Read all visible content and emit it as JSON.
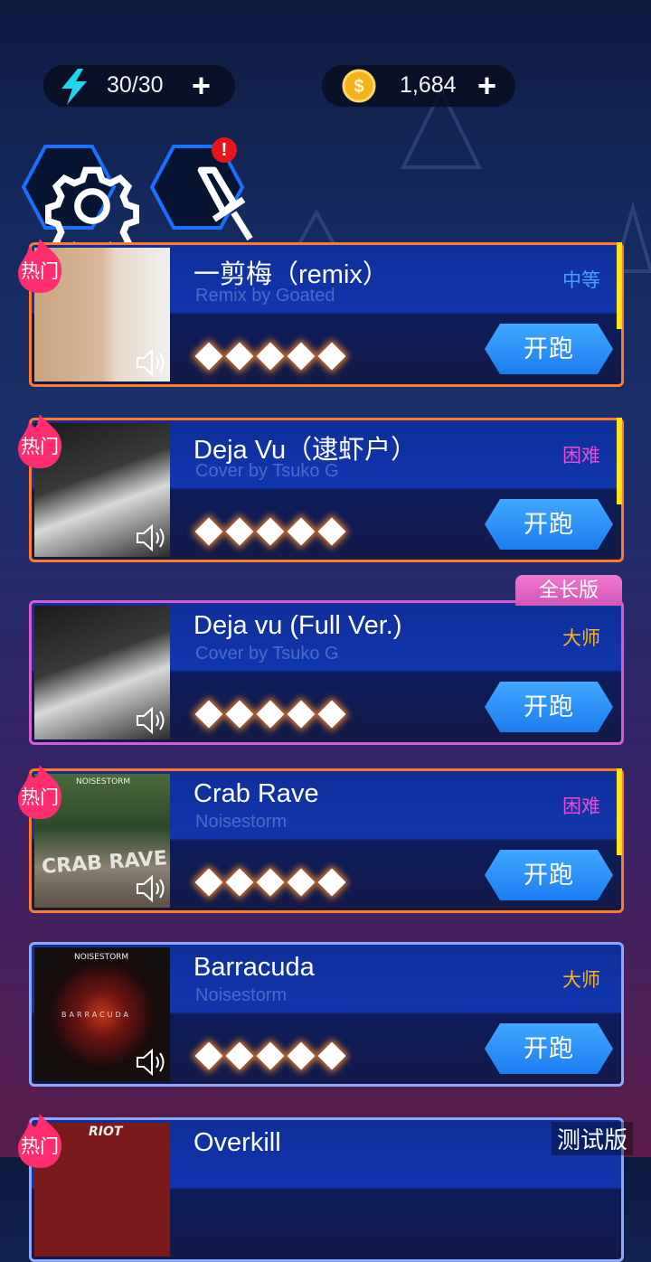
{
  "top_bar": {
    "energy": {
      "icon": "lightning-icon",
      "value": "30/30",
      "plus": "+"
    },
    "coins": {
      "icon": "coin-icon",
      "value": "1,684",
      "plus": "+"
    }
  },
  "buttons": {
    "settings": {
      "icon": "gear-icon"
    },
    "equipment": {
      "icon": "sword-icon",
      "alert": "!"
    }
  },
  "songs": [
    {
      "title": "一剪梅（remix）",
      "subtitle": "Remix by Goated",
      "difficulty": "中等",
      "diff_color": "#4aa0ff",
      "start": "开跑",
      "hot": "热门",
      "frame": "#ff7a2a",
      "yellow": true
    },
    {
      "title": "Deja Vu（逮虾户）",
      "subtitle": "Cover by Tsuko G",
      "difficulty": "困难",
      "diff_color": "#e84bd8",
      "start": "开跑",
      "hot": "热门",
      "frame": "#ff7a2a",
      "yellow": true
    },
    {
      "title": "Deja vu (Full Ver.)",
      "subtitle": "Cover by Tsuko G",
      "difficulty": "大师",
      "diff_color": "#ffb21a",
      "start": "开跑",
      "tag": "全长版",
      "frame": "#d85bd0"
    },
    {
      "title": "Crab Rave",
      "subtitle": "Noisestorm",
      "difficulty": "困难",
      "diff_color": "#e84bd8",
      "start": "开跑",
      "hot": "热门",
      "frame": "#ff7a2a",
      "yellow": true
    },
    {
      "title": "Barracuda",
      "subtitle": "Noisestorm",
      "difficulty": "大师",
      "diff_color": "#ffb21a",
      "start": "开跑",
      "frame": "#8fa8ff"
    },
    {
      "title": "Overkill",
      "hot": "热门",
      "frame": "#8fa8ff"
    }
  ],
  "cover_text": {
    "crab": "CRAB RAVE",
    "noisestorm_1": "NOISESTORM",
    "noisestorm_2": "NOISESTORM",
    "barracuda": "BARRACUDA",
    "riot": "RIOT"
  },
  "watermark": "测试版"
}
